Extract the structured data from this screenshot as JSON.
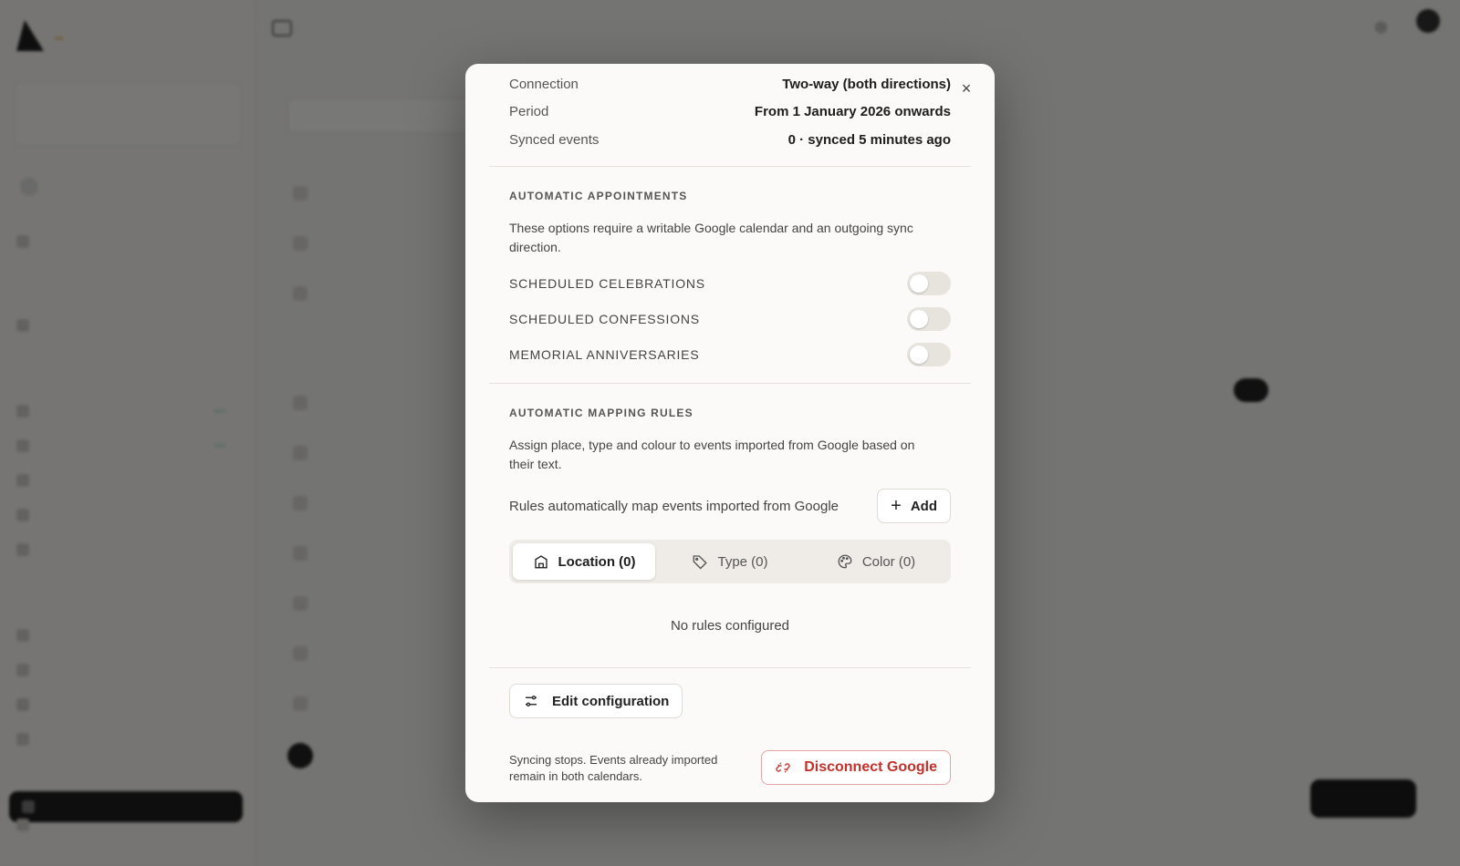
{
  "modal": {
    "close_glyph": "×",
    "info_rows": [
      {
        "label": "Connection",
        "value": "Two-way (both directions)"
      },
      {
        "label": "Period",
        "value": "From 1 January 2026 onwards"
      },
      {
        "label": "Synced events",
        "value": "0 · synced 5 minutes ago"
      }
    ],
    "auto_appointments": {
      "title": "AUTOMATIC APPOINTMENTS",
      "description": "These options require a writable Google calendar and an outgoing sync direction.",
      "toggles": [
        {
          "label": "SCHEDULED CELEBRATIONS",
          "on": false
        },
        {
          "label": "SCHEDULED CONFESSIONS",
          "on": false
        },
        {
          "label": "MEMORIAL ANNIVERSARIES",
          "on": false
        }
      ]
    },
    "mapping_rules": {
      "title": "AUTOMATIC MAPPING RULES",
      "description": "Assign place, type and colour to events imported from Google based on their text.",
      "add_line": "Rules automatically map events imported from Google",
      "add_label": "Add",
      "tabs": [
        {
          "label": "Location (0)",
          "icon": "building-icon",
          "active": true
        },
        {
          "label": "Type (0)",
          "icon": "tag-icon",
          "active": false
        },
        {
          "label": "Color (0)",
          "icon": "palette-icon",
          "active": false
        }
      ],
      "empty_text": "No rules configured"
    },
    "edit_label": "Edit configuration",
    "footer_note": "Syncing stops. Events already imported remain in both calendars.",
    "disconnect_label": "Disconnect Google"
  },
  "colors": {
    "danger": "#c4302b",
    "overlay": "rgba(0,0,0,0.52)"
  }
}
